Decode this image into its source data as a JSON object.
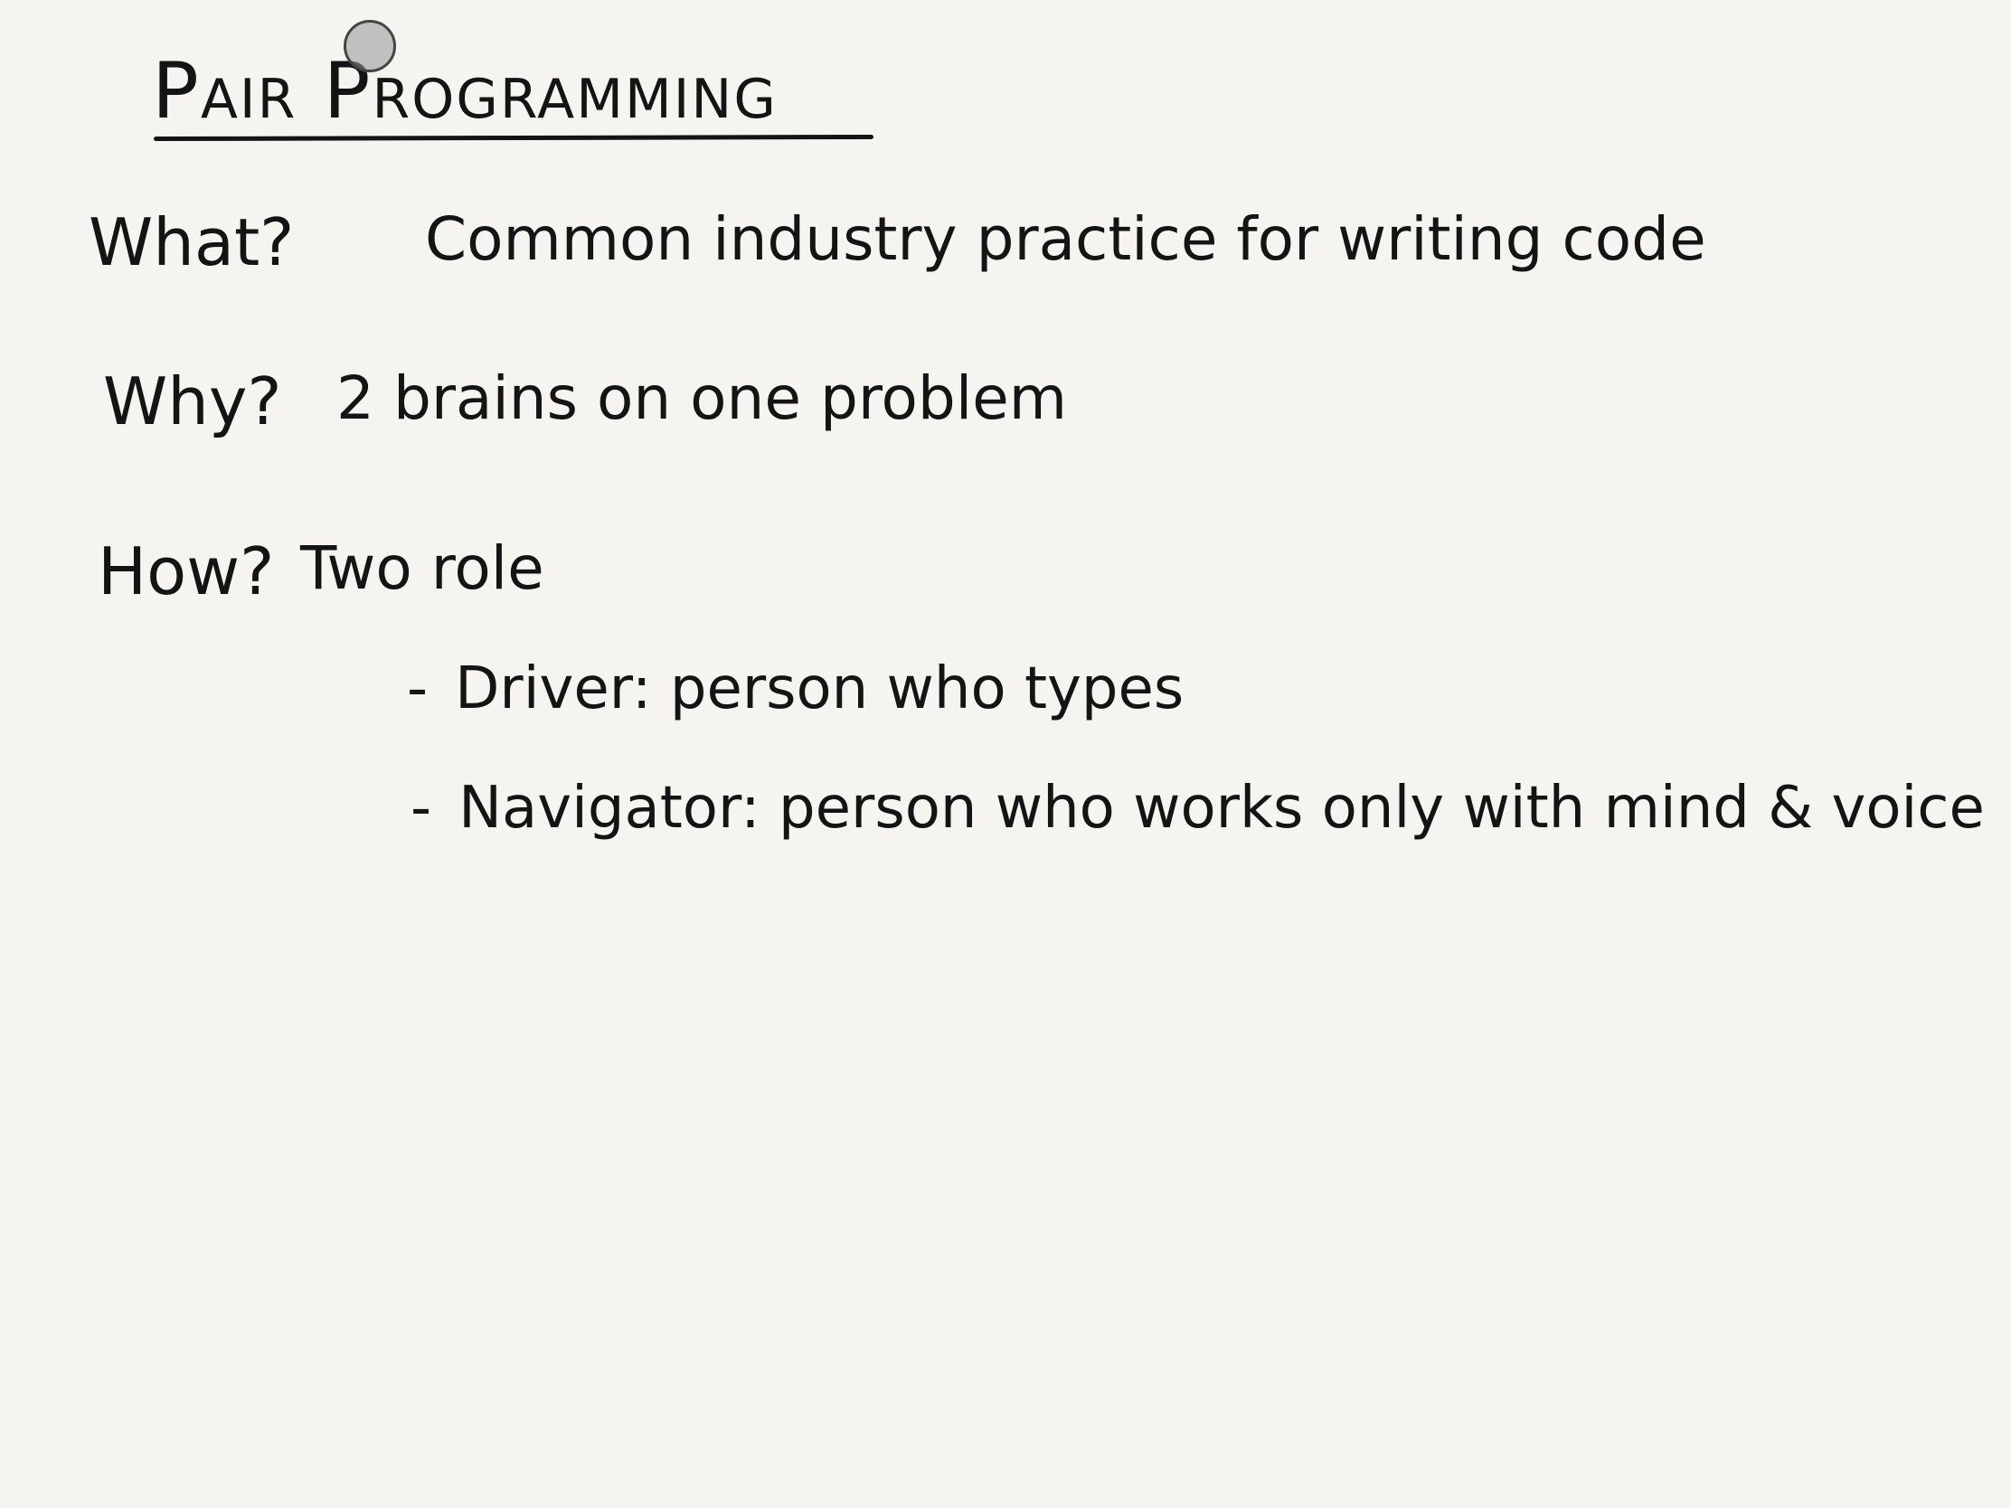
{
  "note": {
    "title": "Pair Programming",
    "rows": [
      {
        "question": "What?",
        "answer": "Common industry practice for writing code"
      },
      {
        "question": "Why?",
        "answer": "2 brains on one problem"
      },
      {
        "question": "How?",
        "answer": "Two role"
      }
    ],
    "roles": [
      {
        "dash": "-",
        "text": "Driver: person who types"
      },
      {
        "dash": "-",
        "text": "Navigator: person who works only with mind & voice"
      }
    ]
  },
  "colors": {
    "background": "#f5f4f0",
    "ink": "#141414",
    "pointer": "#969696"
  }
}
